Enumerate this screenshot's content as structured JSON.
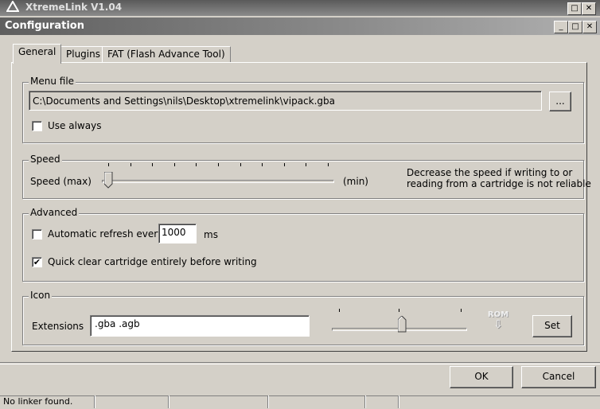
{
  "parent_window": {
    "title": "XtremeLink V1.04"
  },
  "dialog": {
    "title": "Configuration"
  },
  "tabs": [
    {
      "label": "General"
    },
    {
      "label": "Plugins"
    },
    {
      "label": "FAT (Flash Advance Tool)"
    }
  ],
  "menu_file": {
    "legend": "Menu file",
    "path": "C:\\Documents and Settings\\nils\\Desktop\\xtremelink\\vipack.gba",
    "browse_label": "...",
    "use_always_label": "Use always",
    "use_always_checked": false
  },
  "speed": {
    "legend": "Speed",
    "label_left": "Speed  (max)",
    "label_right": "(min)",
    "hint_line1": "Decrease the speed if writing to or",
    "hint_line2": "reading from a cartridge is not reliable",
    "value_fraction": 0.0
  },
  "advanced": {
    "legend": "Advanced",
    "auto_refresh_label": "Automatic refresh every",
    "auto_refresh_checked": false,
    "refresh_value": "1000",
    "refresh_unit": "ms",
    "quick_clear_label": "Quick clear cartridge entirely before writing",
    "quick_clear_checked": true
  },
  "icon": {
    "legend": "Icon",
    "extensions_label": "Extensions",
    "extensions_value": ".gba .agb",
    "rom_icon_label": "ROM",
    "set_label": "Set",
    "slider_fraction": 0.5
  },
  "footer": {
    "ok_label": "OK",
    "cancel_label": "Cancel"
  },
  "status_bar": {
    "text": "No linker found."
  }
}
